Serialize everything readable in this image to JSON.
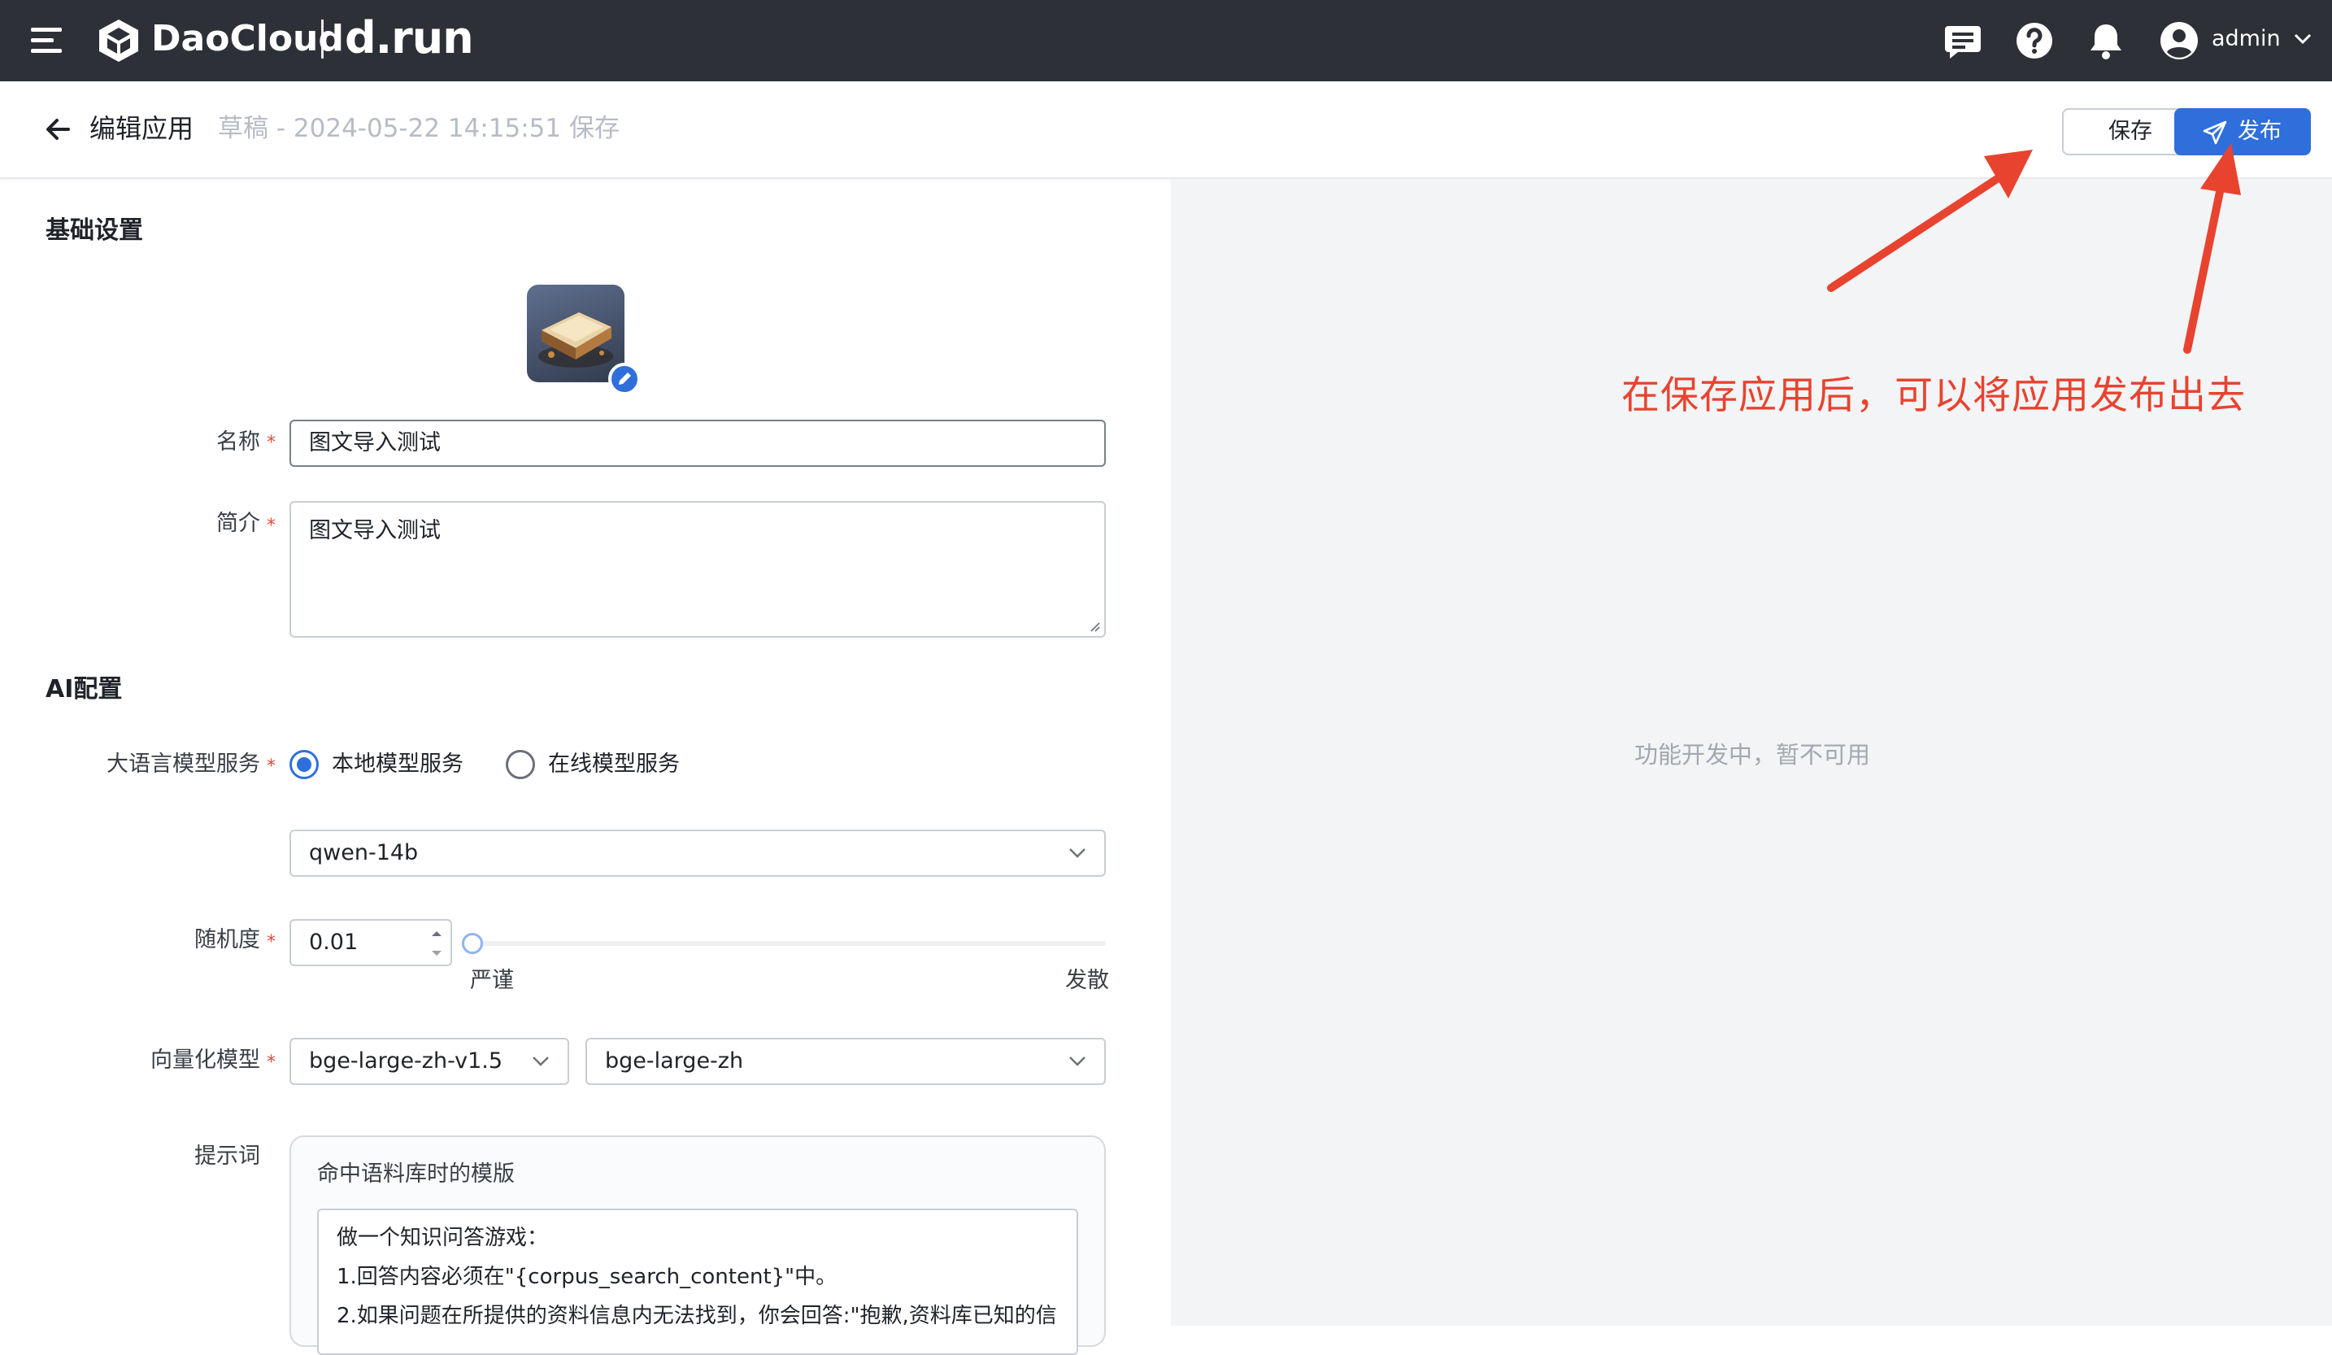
{
  "topbar": {
    "brand": "DaoCloud",
    "product": "d.run",
    "user": "admin",
    "icons": [
      "menu-icon",
      "daocloud-logo",
      "message-icon",
      "help-icon",
      "bell-icon",
      "user-avatar-icon",
      "chevron-down-icon"
    ]
  },
  "header": {
    "title": "编辑应用",
    "draft_status": "草稿 - 2024-05-22 14:15:51 保存",
    "save_label": "保存",
    "publish_label": "发布"
  },
  "form": {
    "basic_section": "基础设置",
    "name_label": "名称",
    "name_value": "图文导入测试",
    "desc_label": "简介",
    "desc_value": "图文导入测试",
    "ai_section": "AI配置",
    "llm_label": "大语言模型服务",
    "llm_options": [
      "本地模型服务",
      "在线模型服务"
    ],
    "llm_selected": "本地模型服务",
    "model_value": "qwen-14b",
    "randomness_label": "随机度",
    "randomness_value": "0.01",
    "randomness_level": 0.01,
    "slider_min_label": "严谨",
    "slider_max_label": "发散",
    "vector_label": "向量化模型",
    "vector_model_1": "bge-large-zh-v1.5",
    "vector_model_2": "bge-large-zh",
    "prompt_label": "提示词",
    "prompt_template_title": "命中语料库时的模版",
    "prompt_lines": [
      "做一个知识问答游戏：",
      "1.回答内容必须在\"{corpus_search_content}\"中。",
      "2.如果问题在所提供的资料信息内无法找到，你会回答:\"抱歉,资料库已知的信"
    ]
  },
  "right_pane": {
    "placeholder": "功能开发中，暂不可用",
    "annotation": "在保存应用后，可以将应用发布出去"
  },
  "colors": {
    "topbar": "#2d3036",
    "primary": "#2f6fdc",
    "annotation": "#e8432f",
    "required": "#e5483a",
    "right_pane_bg": "#f3f4f6"
  }
}
